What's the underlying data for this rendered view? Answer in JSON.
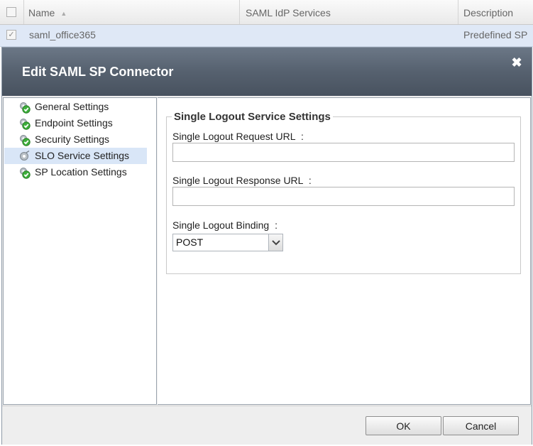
{
  "grid": {
    "columns": {
      "name": "Name",
      "idp_services": "SAML IdP Services",
      "description": "Description"
    },
    "rows": [
      {
        "name": "saml_office365",
        "idp_services": "",
        "description": "Predefined SP",
        "checked": true
      }
    ]
  },
  "dialog": {
    "title": "Edit SAML SP Connector",
    "close_icon": "close-icon",
    "nav": [
      {
        "label": "General Settings",
        "icon": "check-gear-icon",
        "active": false
      },
      {
        "label": "Endpoint Settings",
        "icon": "check-gear-icon",
        "active": false
      },
      {
        "label": "Security Settings",
        "icon": "check-gear-icon",
        "active": false
      },
      {
        "label": "SLO Service Settings",
        "icon": "gear-icon",
        "active": true
      },
      {
        "label": "SP Location Settings",
        "icon": "check-gear-icon",
        "active": false
      }
    ],
    "slo": {
      "legend": "Single Logout Service Settings",
      "request_url_label": "Single Logout Request URL",
      "request_url_value": "",
      "response_url_label": "Single Logout Response URL",
      "response_url_value": "",
      "binding_label": "Single Logout Binding",
      "binding_value": "POST",
      "label_suffix": ":"
    },
    "buttons": {
      "ok": "OK",
      "cancel": "Cancel"
    }
  },
  "colors": {
    "header": "#56616f",
    "nav_active": "#d9e6f7",
    "check_green": "#3cae3a"
  }
}
